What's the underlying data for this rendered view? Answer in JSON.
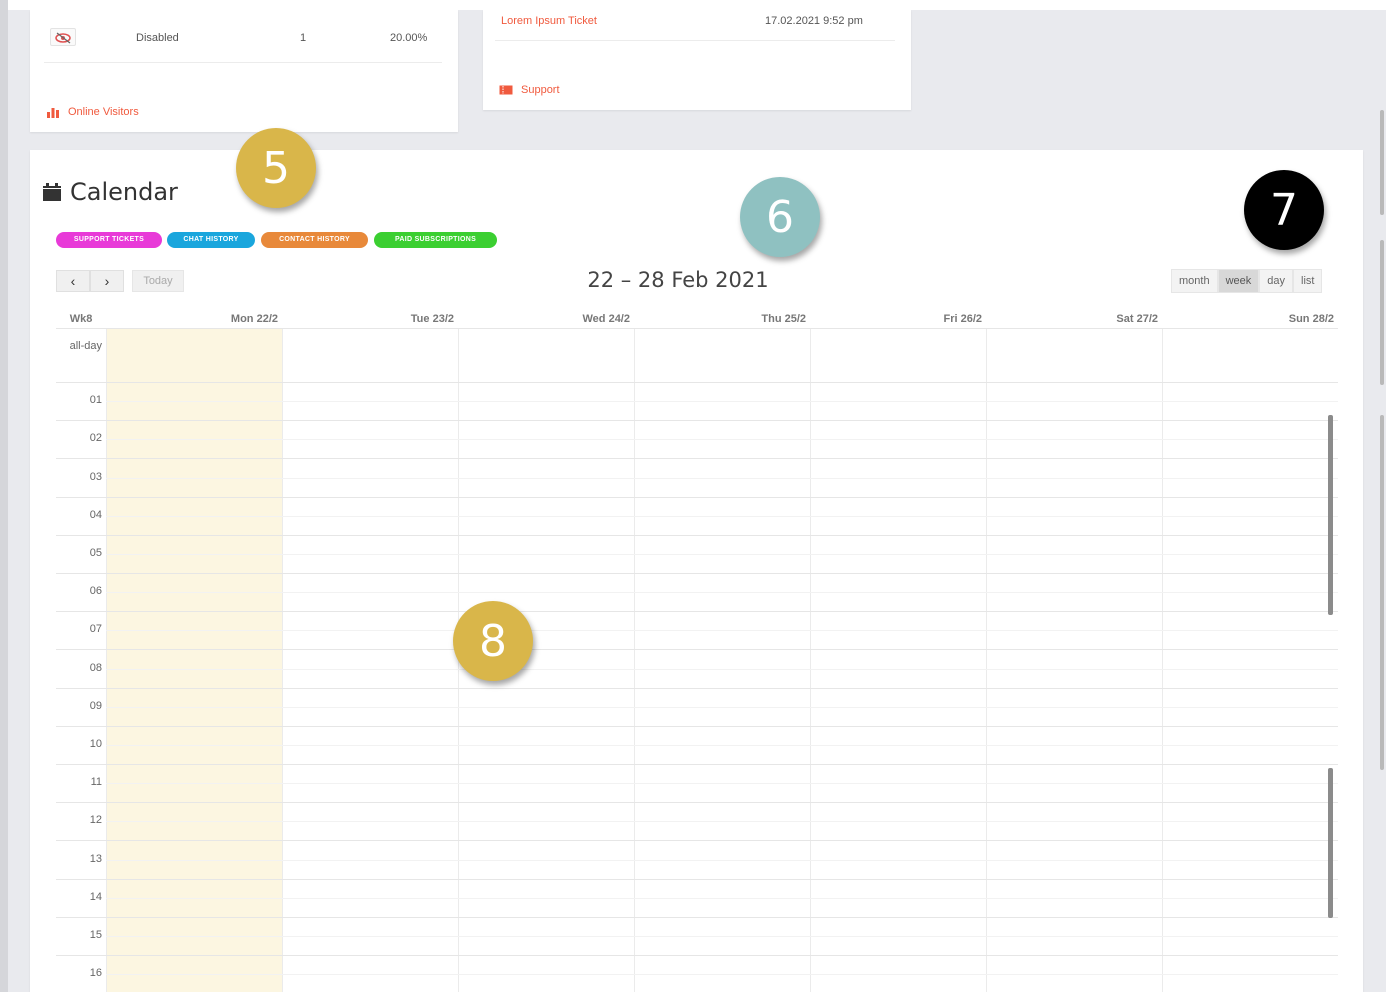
{
  "top_cards": {
    "visitors_row": {
      "label": "Disabled",
      "count": "1",
      "percent": "20.00%"
    },
    "visitors_link": "Online Visitors",
    "ticket_row": {
      "title": "Lorem Ipsum Ticket",
      "date": "17.02.2021 9:52 pm"
    },
    "support_link": "Support"
  },
  "calendar": {
    "title": "Calendar",
    "legend": [
      {
        "label": "SUPPORT TICKETS",
        "color": "#e83ad8"
      },
      {
        "label": "CHAT HISTORY",
        "color": "#1aa6dd"
      },
      {
        "label": "CONTACT HISTORY",
        "color": "#e8893a"
      },
      {
        "label": "PAID SUBSCRIPTIONS",
        "color": "#3bcf31"
      }
    ],
    "nav": {
      "prev": "‹",
      "next": "›",
      "today": "Today"
    },
    "range_title": "22 – 28 Feb 2021",
    "views": [
      {
        "label": "month",
        "active": false
      },
      {
        "label": "week",
        "active": true
      },
      {
        "label": "day",
        "active": false
      },
      {
        "label": "list",
        "active": false
      }
    ],
    "week_header": "Wk8",
    "days": [
      "Mon 22/2",
      "Tue 23/2",
      "Wed 24/2",
      "Thu 25/2",
      "Fri 26/2",
      "Sat 27/2",
      "Sun 28/2"
    ],
    "all_day_label": "all-day",
    "hours": [
      "01",
      "02",
      "03",
      "04",
      "05",
      "06",
      "07",
      "08",
      "09",
      "10",
      "11",
      "12",
      "13",
      "14",
      "15",
      "16"
    ]
  },
  "badges": [
    {
      "number": "5",
      "color": "#d9b64a",
      "text_color": "#ffffff"
    },
    {
      "number": "6",
      "color": "#8fc1c1",
      "text_color": "#ffffff"
    },
    {
      "number": "7",
      "color": "#000000",
      "text_color": "#ffffff"
    },
    {
      "number": "8",
      "color": "#d9b64a",
      "text_color": "#ffffff"
    }
  ]
}
